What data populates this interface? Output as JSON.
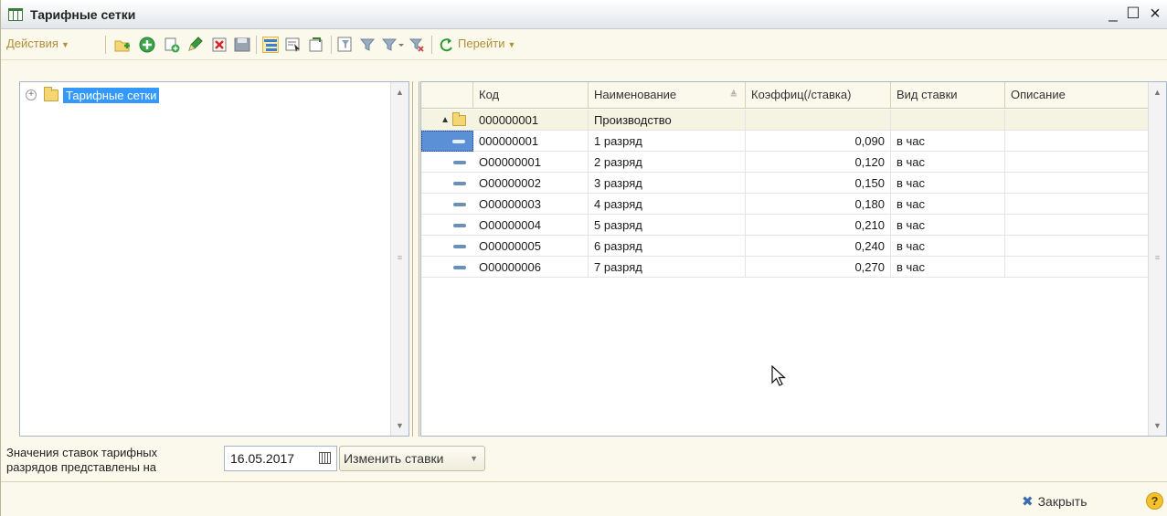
{
  "window": {
    "title": "Тарифные сетки",
    "minimize": "_",
    "maximize": "☐",
    "close": "×"
  },
  "toolbar": {
    "actions_label": "Действия",
    "goto_label": "Перейти"
  },
  "tree": {
    "root_label": "Тарифные сетки"
  },
  "grid": {
    "columns": [
      "Код",
      "Наименование",
      "Коэффиц(/ставка)",
      "Вид ставки",
      "Описание"
    ],
    "group_row": {
      "code": "000000001",
      "name": "Производство"
    },
    "rows": [
      {
        "code": "000000001",
        "name": "1 разряд",
        "coef": "0,090",
        "rate_type": "в час",
        "desc": ""
      },
      {
        "code": "O00000001",
        "name": "2 разряд",
        "coef": "0,120",
        "rate_type": "в час",
        "desc": ""
      },
      {
        "code": "O00000002",
        "name": "3 разряд",
        "coef": "0,150",
        "rate_type": "в час",
        "desc": ""
      },
      {
        "code": "O00000003",
        "name": "4 разряд",
        "coef": "0,180",
        "rate_type": "в час",
        "desc": ""
      },
      {
        "code": "O00000004",
        "name": "5 разряд",
        "coef": "0,210",
        "rate_type": "в час",
        "desc": ""
      },
      {
        "code": "O00000005",
        "name": "6 разряд",
        "coef": "0,240",
        "rate_type": "в час",
        "desc": ""
      },
      {
        "code": "O00000006",
        "name": "7 разряд",
        "coef": "0,270",
        "rate_type": "в час",
        "desc": ""
      }
    ]
  },
  "bottom": {
    "label_line1": "Значения ставок тарифных",
    "label_line2": "разрядов представлены на",
    "date_value": "16.05.2017",
    "change_rates_label": "Изменить ставки"
  },
  "footer": {
    "close_label": "Закрыть",
    "help_label": "?"
  }
}
